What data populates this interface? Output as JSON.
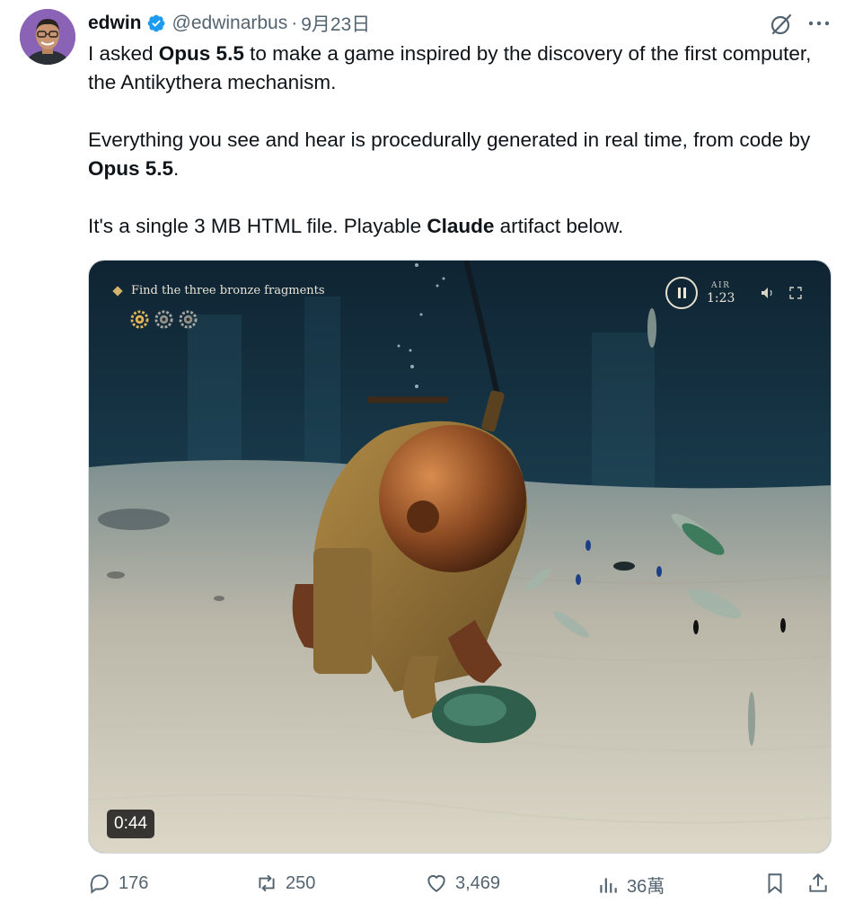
{
  "author": {
    "name": "edwin",
    "handle": "@edwinarbus",
    "separator": "·",
    "date": "9月23日",
    "avatar_icon": "avatar",
    "verified_icon": "verified-badge-icon"
  },
  "tweet": {
    "p1_a": "I asked ",
    "p1_b": "Opus 5.5",
    "p1_c": " to make a game inspired by the discovery of the first computer, the Antikythera mechanism.",
    "p2_a": "Everything you see and hear is procedurally generated in real time, from code by ",
    "p2_b": "Opus 5.5",
    "p2_c": ".",
    "p3_a": "It's a single 3 MB HTML file. Playable ",
    "p3_b": "Claude",
    "p3_c": " artifact below."
  },
  "video": {
    "quest_text": "Find the three bronze fragments",
    "air_label": "AIR",
    "air_time": "1:23",
    "duration": "0:44",
    "fragments_total": 3,
    "fragments_found": 1
  },
  "actions": {
    "replies": "176",
    "retweets": "250",
    "likes": "3,469",
    "views": "36萬"
  },
  "colors": {
    "text": "#0f1419",
    "muted": "#536471",
    "verified": "#1d9bf0",
    "water": "#16323f",
    "sand": "#c9c6b8"
  }
}
